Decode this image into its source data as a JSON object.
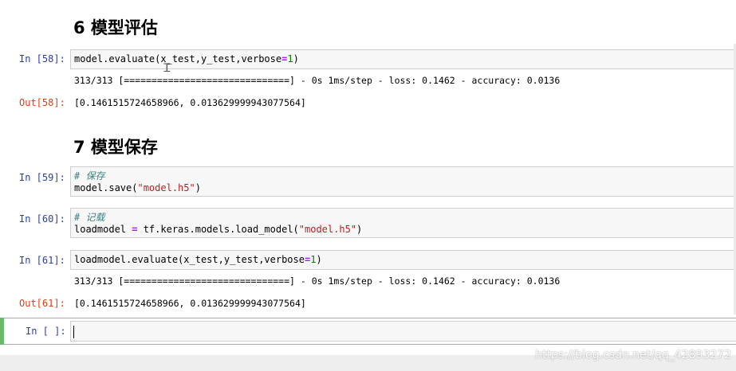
{
  "sections": [
    {
      "title": "6  模型评估"
    },
    {
      "title": "7  模型保存"
    }
  ],
  "cells": [
    {
      "prompt": "In [58]:",
      "code": [
        [
          {
            "t": "model.evaluate(x_test,y_test,verbose",
            "c": "fn"
          },
          {
            "t": "=",
            "c": "op"
          },
          {
            "t": "1",
            "c": "num"
          },
          {
            "t": ")",
            "c": "fn"
          }
        ]
      ],
      "stdout": "313/313 [==============================] - 0s 1ms/step - loss: 0.1462 - accuracy: 0.0136",
      "out_prompt": "Out[58]:",
      "out": "[0.1461515724658966, 0.013629999943077564]"
    },
    {
      "prompt": "In [59]:",
      "code": [
        [
          {
            "t": "# 保存",
            "c": "cm"
          }
        ],
        [
          {
            "t": "model.save(",
            "c": "fn"
          },
          {
            "t": "\"model.h5\"",
            "c": "str"
          },
          {
            "t": ")",
            "c": "fn"
          }
        ]
      ]
    },
    {
      "prompt": "In [60]:",
      "code": [
        [
          {
            "t": "# 记载",
            "c": "cm"
          }
        ],
        [
          {
            "t": "loadmodel ",
            "c": "fn"
          },
          {
            "t": "=",
            "c": "op"
          },
          {
            "t": " tf.keras.models.load_model(",
            "c": "fn"
          },
          {
            "t": "\"model.h5\"",
            "c": "str"
          },
          {
            "t": ")",
            "c": "fn"
          }
        ]
      ]
    },
    {
      "prompt": "In [61]:",
      "code": [
        [
          {
            "t": "loadmodel.evaluate(x_test,y_test,verbose",
            "c": "fn"
          },
          {
            "t": "=",
            "c": "op"
          },
          {
            "t": "1",
            "c": "num"
          },
          {
            "t": ")",
            "c": "fn"
          }
        ]
      ],
      "stdout": "313/313 [==============================] - 0s 1ms/step - loss: 0.1462 - accuracy: 0.0136",
      "out_prompt": "Out[61]:",
      "out": "[0.1461515724658966, 0.013629999943077564]"
    },
    {
      "prompt": "In [ ]:",
      "code": []
    }
  ],
  "watermark": "https://blog.csdn.net/qq_42893272",
  "colors": {
    "in_prompt": "#303f9f",
    "out_prompt": "#d84315",
    "active_bar": "#66bb6a"
  }
}
